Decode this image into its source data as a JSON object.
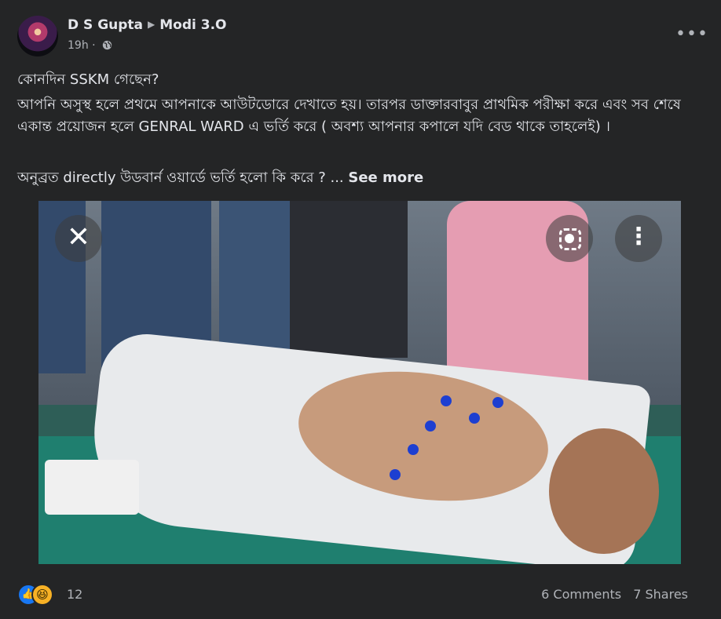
{
  "post": {
    "author": "D S Gupta",
    "group": "Modi 3.O",
    "time": "19h",
    "separator": "·",
    "paragraphs": [
      "কোনদিন SSKM গেছেন?",
      "আপনি অসুস্থ হলে প্রথমে আপনাকে আউটডোরে দেখাতে হয়। তারপর ডাক্তারবাবুর প্রাথমিক পরীক্ষা করে এবং সব শেষে একান্ত প্রয়োজন হলে GENRAL WARD এ ভর্তি করে ( অবশ্য আপনার কপালে যদি বেড থাকে তাহলেই) ।",
      "অনুব্রত directly উডবার্ন ওয়ার্ডে ভর্তি হলো কি করে ? ..."
    ],
    "see_more": "See more"
  },
  "photo": {
    "close_glyph": "✕",
    "more_glyph": "⋮",
    "icons": [
      "close-icon",
      "lens-icon",
      "more-vertical-icon"
    ]
  },
  "footer": {
    "reaction_icons": [
      "like-icon",
      "haha-icon"
    ],
    "reaction_count": "12",
    "comments": "6 Comments",
    "shares": "7 Shares"
  },
  "header": {
    "more_glyph": "•••",
    "icons": [
      "arrow-right-icon",
      "globe-icon",
      "more-horizontal-icon"
    ]
  },
  "colors": {
    "card_bg": "#242526",
    "text": "#e4e6eb",
    "muted": "#b0b3b8",
    "like_blue": "#1877f2",
    "haha_yellow": "#f7b125"
  }
}
